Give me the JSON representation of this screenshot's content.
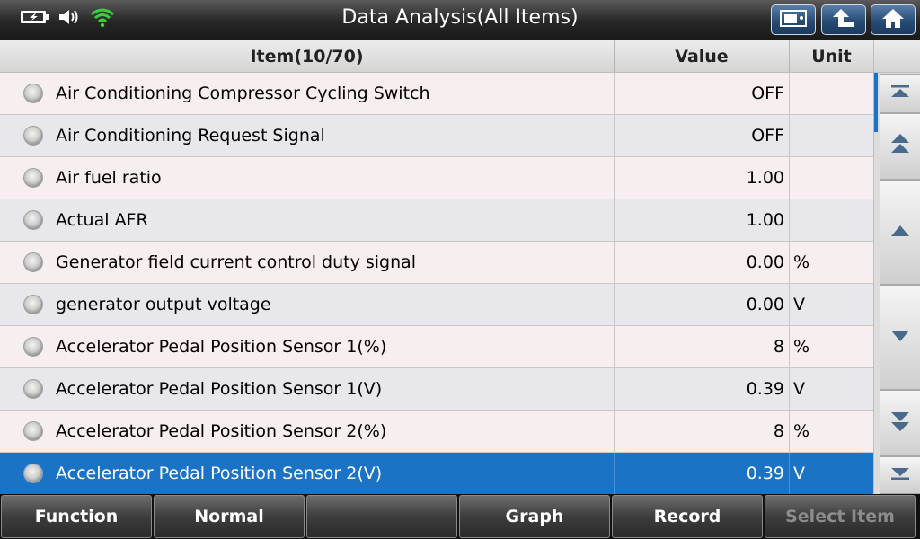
{
  "header": {
    "title": "Data Analysis(All Items)",
    "status_icons": [
      "battery-charging-icon",
      "speaker-icon",
      "wifi-icon"
    ],
    "buttons": [
      "screenshot-icon",
      "back-icon",
      "home-icon"
    ]
  },
  "table": {
    "columns": {
      "item": "Item(10/70)",
      "value": "Value",
      "unit": "Unit"
    },
    "rows": [
      {
        "item": "Air Conditioning Compressor Cycling Switch",
        "value": "OFF",
        "unit": ""
      },
      {
        "item": "Air Conditioning Request Signal",
        "value": "OFF",
        "unit": ""
      },
      {
        "item": "Air fuel ratio",
        "value": "1.00",
        "unit": ""
      },
      {
        "item": "Actual AFR",
        "value": "1.00",
        "unit": ""
      },
      {
        "item": "Generator field current control duty signal",
        "value": "0.00",
        "unit": "%"
      },
      {
        "item": "generator output voltage",
        "value": "0.00",
        "unit": "V"
      },
      {
        "item": "Accelerator Pedal Position Sensor 1(%)",
        "value": "8",
        "unit": "%"
      },
      {
        "item": "Accelerator Pedal Position Sensor 1(V)",
        "value": "0.39",
        "unit": "V"
      },
      {
        "item": "Accelerator Pedal Position Sensor 2(%)",
        "value": "8",
        "unit": "%"
      },
      {
        "item": "Accelerator Pedal Position Sensor 2(V)",
        "value": "0.39",
        "unit": "V"
      }
    ],
    "selected_index": 9
  },
  "footer": {
    "buttons": [
      "Function",
      "Normal",
      "",
      "Graph",
      "Record",
      "Select Item"
    ]
  },
  "colors": {
    "selection": "#1a73c4",
    "wifi": "#3ad13a"
  }
}
